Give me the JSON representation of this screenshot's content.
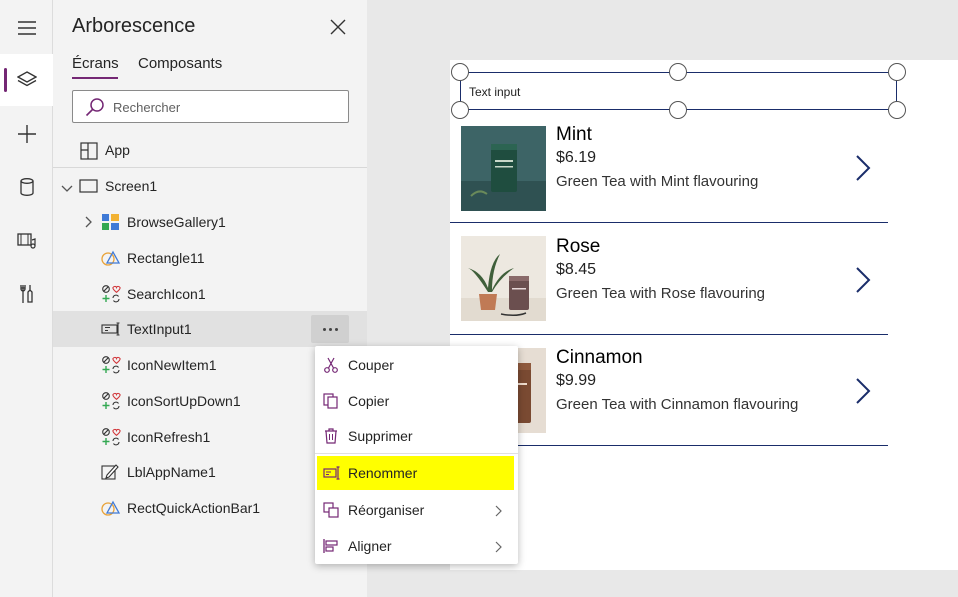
{
  "rail": {
    "items": [
      {
        "icon": "hamburger-menu-icon"
      },
      {
        "icon": "layers-icon",
        "active": true
      },
      {
        "icon": "plus-icon"
      },
      {
        "icon": "database-icon"
      },
      {
        "icon": "media-icon"
      },
      {
        "icon": "tools-icon"
      }
    ]
  },
  "panel": {
    "title": "Arborescence",
    "tabs": [
      {
        "label": "Écrans",
        "active": true
      },
      {
        "label": "Composants",
        "active": false
      }
    ],
    "search": {
      "placeholder": "Rechercher",
      "value": ""
    },
    "app_label": "App",
    "tree": [
      {
        "label": "Screen1",
        "icon": "screen-icon",
        "expanded": true
      },
      {
        "label": "BrowseGallery1",
        "icon": "gallery-icon",
        "expanded": false
      },
      {
        "label": "Rectangle11",
        "icon": "shape-icon"
      },
      {
        "label": "SearchIcon1",
        "icon": "icon-control-icon"
      },
      {
        "label": "TextInput1",
        "icon": "text-input-icon",
        "selected": true
      },
      {
        "label": "IconNewItem1",
        "icon": "icon-control-icon"
      },
      {
        "label": "IconSortUpDown1",
        "icon": "icon-control-icon"
      },
      {
        "label": "IconRefresh1",
        "icon": "icon-control-icon"
      },
      {
        "label": "LblAppName1",
        "icon": "label-edit-icon"
      },
      {
        "label": "RectQuickActionBar1",
        "icon": "shape-icon"
      }
    ]
  },
  "context_menu": {
    "items": [
      {
        "label": "Couper",
        "icon": "scissors-icon"
      },
      {
        "label": "Copier",
        "icon": "copy-icon"
      },
      {
        "label": "Supprimer",
        "icon": "trash-icon"
      },
      {
        "label": "Renommer",
        "icon": "rename-icon",
        "highlighted": true
      },
      {
        "label": "Réorganiser",
        "icon": "reorder-icon",
        "submenu": true
      },
      {
        "label": "Aligner",
        "icon": "align-icon",
        "submenu": true
      }
    ]
  },
  "canvas": {
    "text_input_value": "Text input",
    "products": [
      {
        "name": "Mint",
        "price": "$6.19",
        "description": "Green Tea with Mint flavouring"
      },
      {
        "name": "Rose",
        "price": "$8.45",
        "description": "Green Tea with Rose flavouring"
      },
      {
        "name": "Cinnamon",
        "price": "$9.99",
        "description": "Green Tea with Cinnamon flavouring"
      }
    ]
  },
  "colors": {
    "accent": "#742774",
    "highlight": "#ffff00",
    "gallery_divider": "#1a2d6a"
  }
}
